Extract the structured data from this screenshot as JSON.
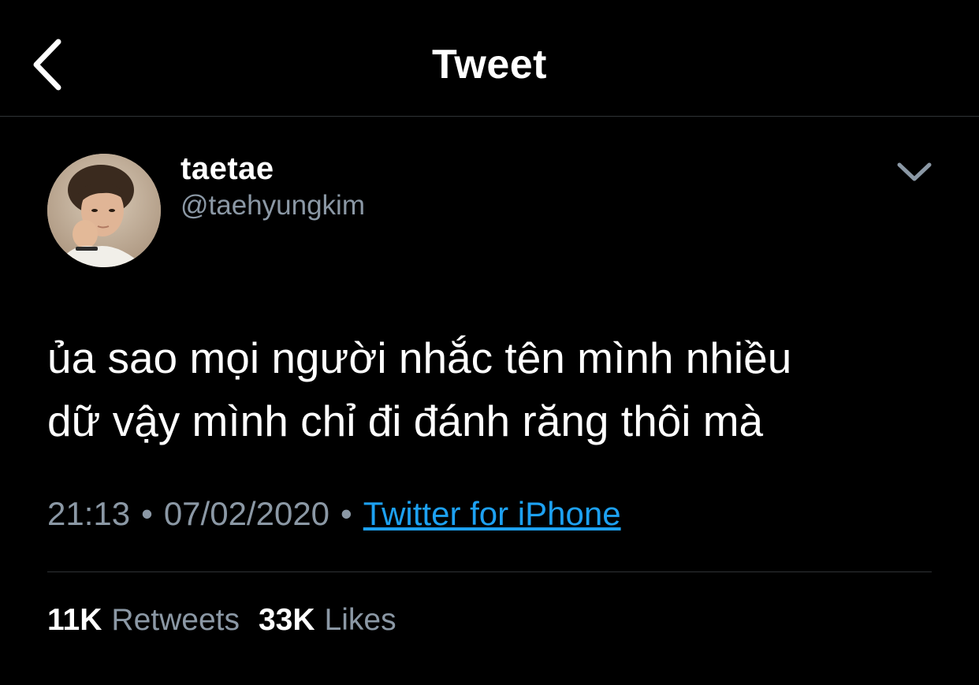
{
  "header": {
    "title": "Tweet",
    "back_icon": "chevron-left-icon"
  },
  "author": {
    "display_name": "taetae",
    "handle": "@taehyungkim",
    "avatar_icon": "profile-photo"
  },
  "more_icon": "chevron-down-icon",
  "tweet": {
    "lines": [
      "ủa sao mọi người nhắc tên mình nhiều",
      "dữ vậy mình chỉ đi đánh răng thôi mà"
    ],
    "time": "21:13",
    "separator": "•",
    "date": "07/02/2020",
    "source": "Twitter for iPhone"
  },
  "stats": {
    "retweets_count": "11K",
    "retweets_label": "Retweets",
    "likes_count": "33K",
    "likes_label": "Likes"
  },
  "colors": {
    "background": "#000000",
    "text": "#ffffff",
    "secondary": "#8b98a5",
    "link": "#1da1f2",
    "divider": "#2f3336"
  }
}
